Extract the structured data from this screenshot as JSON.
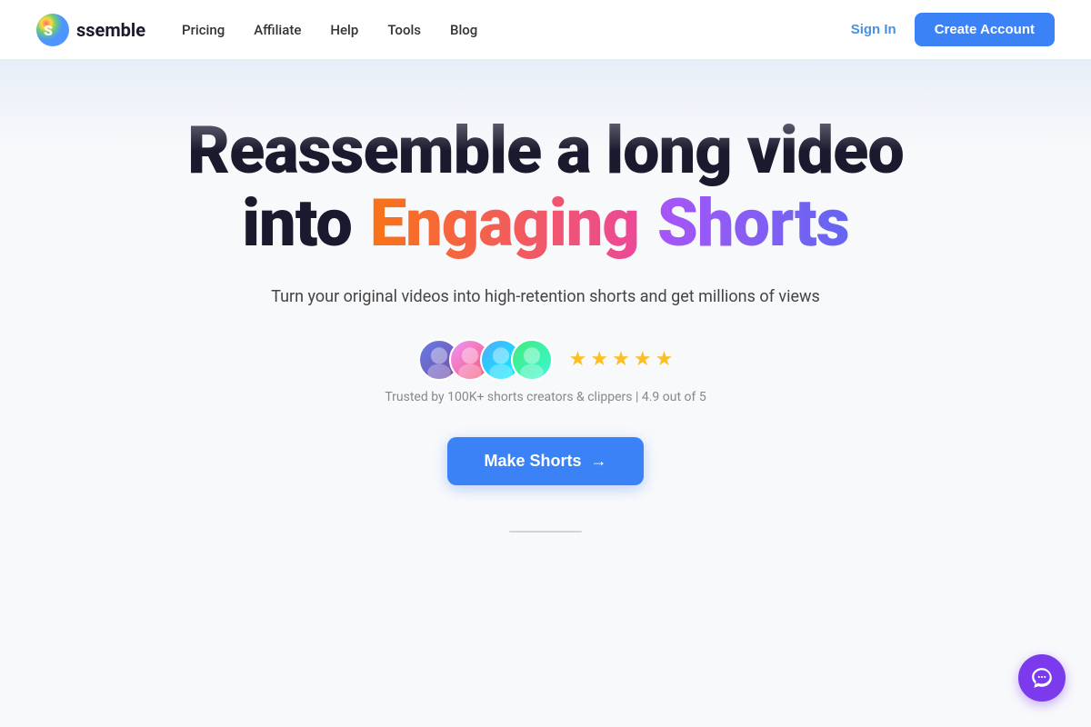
{
  "nav": {
    "logo_text": "ssemble",
    "links": [
      {
        "label": "Pricing",
        "id": "pricing"
      },
      {
        "label": "Affiliate",
        "id": "affiliate"
      },
      {
        "label": "Help",
        "id": "help"
      },
      {
        "label": "Tools",
        "id": "tools"
      },
      {
        "label": "Blog",
        "id": "blog"
      }
    ],
    "sign_in_label": "Sign In",
    "create_account_label": "Create Account"
  },
  "hero": {
    "title_line1": "Reassemble a long video",
    "title_into": "into",
    "title_engaging": "Engaging",
    "title_shorts": "Shorts",
    "subtitle": "Turn your original videos into high-retention shorts and get millions of views"
  },
  "social_proof": {
    "text": "Trusted by 100K+ shorts creators & clippers | 4.9 out of 5",
    "stars": [
      "★",
      "★",
      "★",
      "★",
      "★"
    ]
  },
  "cta": {
    "button_label": "Make Shorts",
    "arrow": "→"
  },
  "chat": {
    "label": "chat-bot"
  }
}
